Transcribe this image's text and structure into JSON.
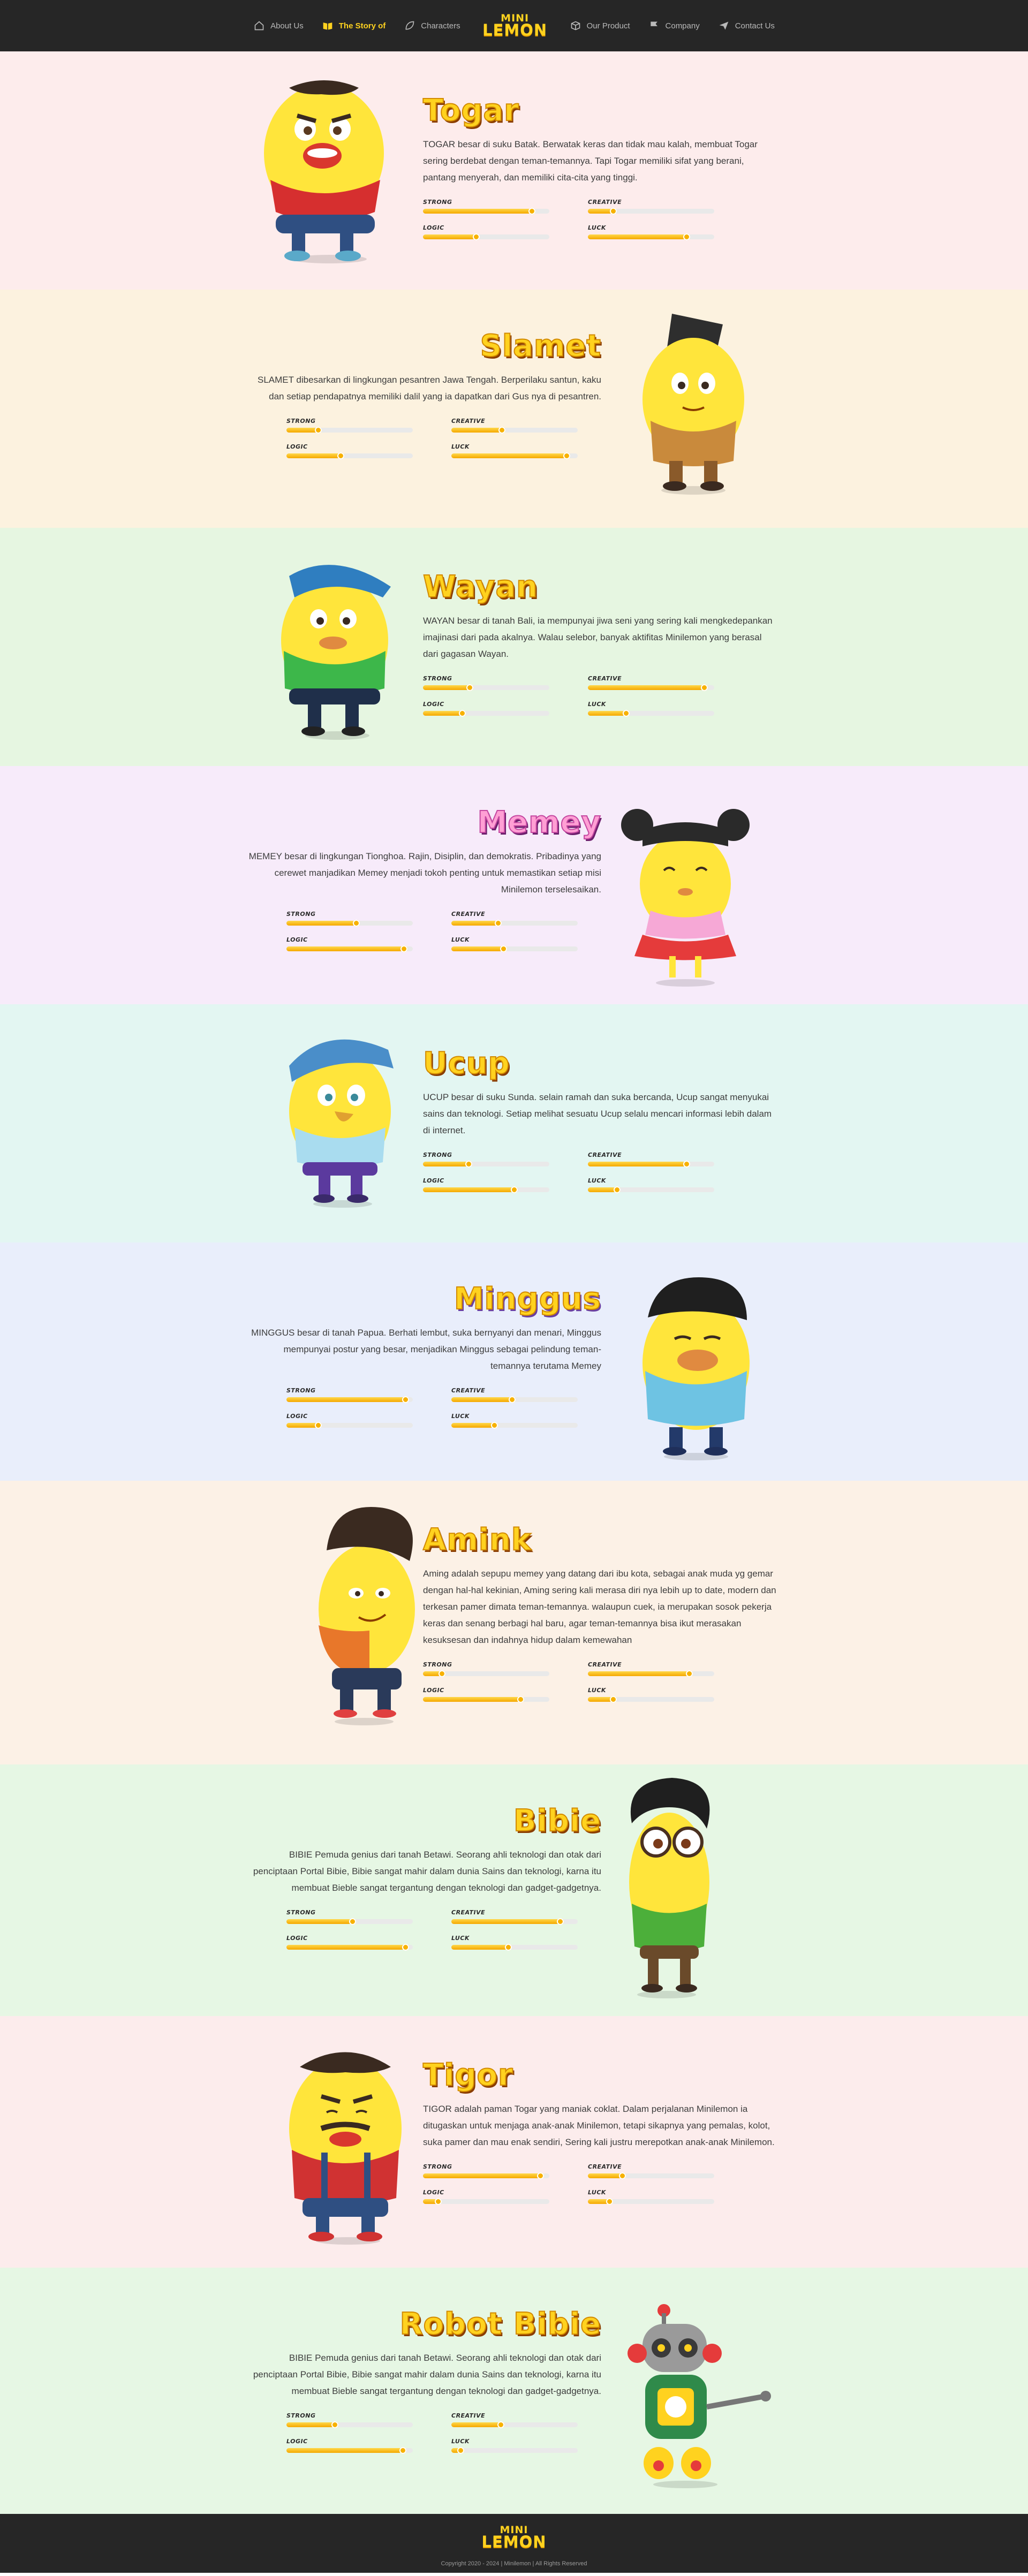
{
  "nav": {
    "items": [
      {
        "label": "About Us",
        "icon": "house-icon"
      },
      {
        "label": "The Story of",
        "icon": "book-icon",
        "active": true
      },
      {
        "label": "Characters",
        "icon": "leaf-icon"
      },
      {
        "label": "Our Product",
        "icon": "box-icon"
      },
      {
        "label": "Company",
        "icon": "flag-icon"
      },
      {
        "label": "Contact Us",
        "icon": "paper-plane-icon"
      }
    ],
    "logo_line1": "MINI",
    "logo_line2": "LEMON"
  },
  "characters": [
    {
      "name": "Togar",
      "bg": "#fdecec",
      "align": "left",
      "desc": "TOGAR besar di suku Batak. Berwatak keras dan tidak mau kalah, membuat Togar sering berdebat dengan teman-temannya. Tapi Togar memiliki sifat yang berani, pantang menyerah, dan memiliki cita-cita yang tinggi.",
      "stats": {
        "strong": 0.86,
        "creative": 0.2,
        "logic": 0.42,
        "luck": 0.78
      }
    },
    {
      "name": "Slamet",
      "bg": "#fcf2df",
      "align": "right",
      "desc": "SLAMET dibesarkan di lingkungan pesantren Jawa Tengah. Berperilaku santun, kaku dan setiap pendapatnya memiliki dalil yang ia dapatkan dari Gus nya di pesantren.",
      "stats": {
        "strong": 0.25,
        "creative": 0.4,
        "logic": 0.43,
        "luck": 0.91
      }
    },
    {
      "name": "Wayan",
      "bg": "#e6f6e1",
      "align": "left",
      "desc": "WAYAN besar di tanah Bali, ia mempunyai jiwa seni yang sering kali mengkedepankan imajinasi dari pada akalnya. Walau selebor, banyak aktifitas Minilemon yang berasal dari gagasan Wayan.",
      "stats": {
        "strong": 0.37,
        "creative": 0.92,
        "logic": 0.31,
        "luck": 0.3
      }
    },
    {
      "name": "Memey",
      "bg": "#f7ebfa",
      "align": "right",
      "desc": "MEMEY besar di lingkungan Tionghoa. Rajin, Disiplin, dan demokratis. Pribadinya yang cerewet manjadikan Memey menjadi tokoh penting untuk memastikan setiap misi Minilemon terselesaikan.",
      "stats": {
        "strong": 0.55,
        "creative": 0.37,
        "logic": 0.93,
        "luck": 0.41
      }
    },
    {
      "name": "Ucup",
      "bg": "#e3f6f2",
      "align": "left",
      "desc": "UCUP besar di suku Sunda. selain ramah dan suka bercanda, Ucup sangat menyukai sains dan teknologi. Setiap melihat sesuatu Ucup selalu mencari informasi lebih dalam di internet.",
      "stats": {
        "strong": 0.36,
        "creative": 0.78,
        "logic": 0.72,
        "luck": 0.23
      }
    },
    {
      "name": "Minggus",
      "bg": "#e9eefb",
      "align": "right",
      "desc": "MINGGUS besar di tanah Papua. Berhati lembut, suka bernyanyi dan menari, Minggus mempunyai postur yang besar, menjadikan Minggus sebagai pelindung teman-temannya terutama Memey",
      "stats": {
        "strong": 0.94,
        "creative": 0.48,
        "logic": 0.25,
        "luck": 0.34
      }
    },
    {
      "name": "Amink",
      "bg": "#fcf1e6",
      "align": "left",
      "desc": "Aming adalah sepupu memey yang datang dari ibu kota, sebagai anak muda yg gemar dengan hal-hal kekinian, Aming sering kali merasa diri nya lebih up to date, modern dan terkesan pamer dimata teman-temannya. walaupun cuek, ia merupakan sosok pekerja keras dan senang berbagi hal baru, agar teman-temannya bisa ikut merasakan kesuksesan dan indahnya hidup dalam kemewahan",
      "stats": {
        "strong": 0.15,
        "creative": 0.8,
        "logic": 0.77,
        "luck": 0.2
      }
    },
    {
      "name": "Bibie",
      "bg": "#e6f7e4",
      "align": "right",
      "desc": "BIBIE Pemuda genius dari tanah Betawi. Seorang ahli teknologi dan otak dari penciptaan Portal Bibie, Bibie sangat mahir dalam dunia Sains dan teknologi, karna itu membuat Bieble sangat tergantung dengan teknologi dan gadget-gadgetnya.",
      "stats": {
        "strong": 0.52,
        "creative": 0.86,
        "logic": 0.94,
        "luck": 0.45
      }
    },
    {
      "name": "Tigor",
      "bg": "#fcecec",
      "align": "left",
      "desc": "TIGOR adalah paman Togar yang maniak coklat. Dalam perjalanan Minilemon ia ditugaskan untuk menjaga anak-anak Minilemon, tetapi sikapnya yang pemalas, kolot, suka pamer dan mau enak sendiri, Sering kali justru merepotkan anak-anak Minilemon.",
      "stats": {
        "strong": 0.93,
        "creative": 0.27,
        "logic": 0.12,
        "luck": 0.17
      }
    },
    {
      "name": "Robot Bibie",
      "bg": "#e6f7e4",
      "align": "right",
      "desc": "BIBIE Pemuda genius dari tanah Betawi. Seorang ahli teknologi dan otak dari penciptaan Portal Bibie, Bibie sangat mahir dalam dunia Sains dan teknologi, karna itu membuat Bieble sangat tergantung dengan teknologi dan gadget-gadgetnya.",
      "stats": {
        "strong": 0.38,
        "creative": 0.39,
        "logic": 0.92,
        "luck": 0.07
      }
    }
  ],
  "stat_labels": {
    "strong": "STRONG",
    "creative": "CREATIVE",
    "logic": "LOGIC",
    "luck": "LUCK"
  },
  "footer": {
    "logo_line1": "MINI",
    "logo_line2": "LEMON",
    "copyright": "Copyright 2020 - 2024 | Minilemon | All Rights Reserved"
  },
  "colors": {
    "accent": "#ffd21f",
    "nav_bg": "#262626"
  }
}
